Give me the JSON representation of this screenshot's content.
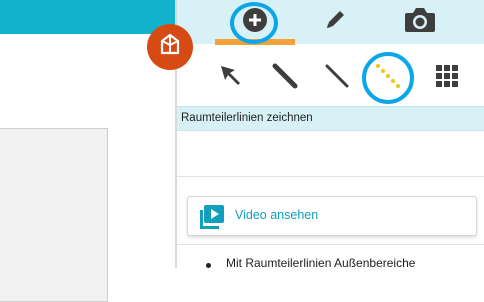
{
  "app": {
    "badge_icon": "room-cube-icon"
  },
  "header": {
    "tabs": [
      {
        "icon": "plus-circle-icon",
        "active": true
      },
      {
        "icon": "pencil-icon",
        "active": false
      },
      {
        "icon": "camera-icon",
        "active": false
      }
    ]
  },
  "toolbar": {
    "tools": [
      "select-arrow-icon",
      "wall-line-icon",
      "thin-line-icon",
      "dotted-room-divider-icon",
      "grid-icon"
    ],
    "selected_tool": "dotted-room-divider-icon"
  },
  "section": {
    "title": "Raumteilerlinien zeichnen"
  },
  "video": {
    "label": "Video ansehen"
  },
  "help": {
    "bullets": [
      "Mit Raumteilerlinien Außenbereiche"
    ]
  },
  "colors": {
    "accent": "#12b1cc",
    "panel_bg": "#d8f1f6",
    "active_underline": "#f2a23a",
    "badge": "#d64a13",
    "highlight_ring": "#0aa6e8",
    "dotted_line": "#f1c40f"
  }
}
